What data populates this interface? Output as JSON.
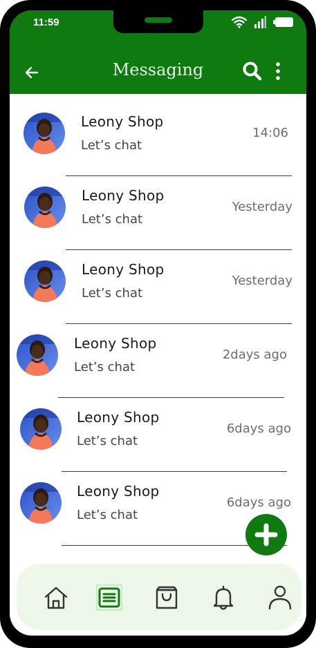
{
  "status_bar": {
    "time": "11:59"
  },
  "app_bar": {
    "title": "Messaging"
  },
  "conversations": [
    {
      "name": "Leony Shop",
      "message": "Let’s chat",
      "time": "14:06"
    },
    {
      "name": "Leony Shop",
      "message": "Let’s chat",
      "time": "Yesterday"
    },
    {
      "name": "Leony Shop",
      "message": "Let’s chat",
      "time": "Yesterday"
    },
    {
      "name": "Leony Shop",
      "message": "Let’s chat",
      "time": "2days ago"
    },
    {
      "name": "Leony Shop",
      "message": "Let’s chat",
      "time": "6days ago"
    },
    {
      "name": "Leony Shop",
      "message": "Let’s chat",
      "time": "6days ago"
    }
  ],
  "bottom_nav": [
    "home-icon",
    "messages-icon",
    "shopping-bag-icon",
    "bell-icon",
    "profile-icon"
  ],
  "colors": {
    "brand": "#0f7a0f",
    "nav_background": "#edf7ea",
    "avatar_background": "#3b6fd8"
  }
}
